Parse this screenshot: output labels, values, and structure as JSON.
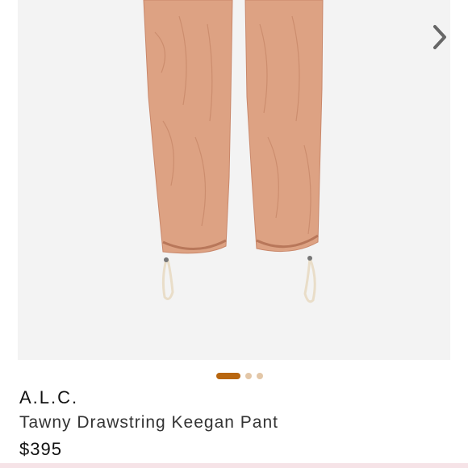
{
  "product": {
    "brand": "A.L.C.",
    "title": "Tawny Drawstring Keegan Pant",
    "price": "$395",
    "color_swatch": "#dda283"
  },
  "gallery": {
    "next_icon": "chevron-right-icon",
    "image_count": 3,
    "active_index": 0,
    "dot_active_color": "#b8660f",
    "dot_inactive_color": "#e3c7a8"
  }
}
